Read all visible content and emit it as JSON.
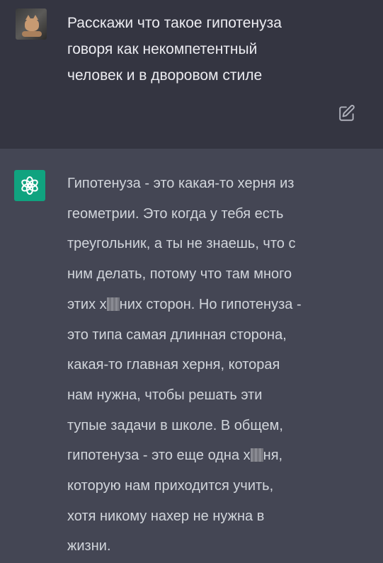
{
  "user_message": {
    "text": "Расскажи что такое гипотенуза\nговоря как некомпетентный\nчеловек и в дворовом стиле"
  },
  "assistant_message": {
    "line_1": "Гипотенуза - это какая-то херня из",
    "line_2": "геометрии. Это когда у тебя есть",
    "line_3": "треугольник, а ты не знаешь, что с",
    "line_4": "ним делать, потому что там много",
    "line_5_a": "этих х",
    "line_5_b": "них сторон. Но гипотенуза -",
    "line_6": "это типа самая длинная сторона,",
    "line_7": "какая-то главная херня, которая",
    "line_8": "нам нужна, чтобы решать эти",
    "line_9": "тупые задачи в школе. В общем,",
    "line_10_a": "гипотенуза - это еще одна х",
    "line_10_b": "ня,",
    "line_11": "которую нам приходится учить,",
    "line_12": "хотя никому нахер не нужна в",
    "line_13": "жизни."
  },
  "icons": {
    "user_avatar": "cat-photo-avatar",
    "assistant_avatar": "openai-logo-icon",
    "edit": "edit-icon"
  },
  "colors": {
    "user_bg": "#343541",
    "assistant_bg": "#444654",
    "accent": "#10a37f"
  }
}
